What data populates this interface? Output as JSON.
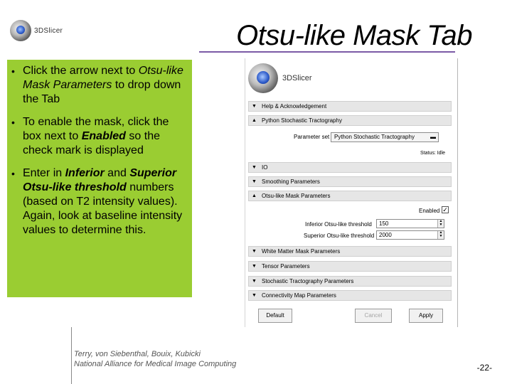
{
  "header": {
    "logo_text": "3DSlicer",
    "title": "Otsu-like Mask Tab"
  },
  "instructions": [
    {
      "parts": [
        {
          "t": "Click the arrow next to ",
          "s": ""
        },
        {
          "t": "Otsu-like Mask Parameters",
          "s": "i"
        },
        {
          "t": " to drop down the Tab",
          "s": ""
        }
      ]
    },
    {
      "parts": [
        {
          "t": "To enable the mask, click the box next to ",
          "s": ""
        },
        {
          "t": "Enabled",
          "s": "bi"
        },
        {
          "t": " so the check mark is displayed",
          "s": ""
        }
      ]
    },
    {
      "parts": [
        {
          "t": "Enter in ",
          "s": ""
        },
        {
          "t": "Inferior",
          "s": "bi"
        },
        {
          "t": " and ",
          "s": ""
        },
        {
          "t": "Superior Otsu-like threshold",
          "s": "bi"
        },
        {
          "t": " numbers (based on T2 intensity values). Again, look at baseline intensity values to determine this.",
          "s": ""
        }
      ]
    }
  ],
  "panel": {
    "logo_text": "3DSlicer",
    "sections": {
      "help": "Help & Acknowledgement",
      "python": "Python Stochastic Tractography",
      "io": "IO",
      "smoothing": "Smoothing Parameters",
      "otsu": "Otsu-like Mask Parameters",
      "white_matter": "White Matter Mask Parameters",
      "tensor": "Tensor Parameters",
      "stochastic": "Stochastic Tractography Parameters",
      "connectivity": "Connectivity Map Parameters"
    },
    "parameter_set_label": "Parameter set",
    "parameter_set_value": "Python Stochastic Tractography",
    "status_text": "Status: Idle",
    "enabled_label": "Enabled",
    "inferior_label": "Inferior Otsu-like threshold",
    "inferior_value": "150",
    "superior_label": "Superior Otsu-like threshold",
    "superior_value": "2000",
    "buttons": {
      "default": "Default",
      "cancel": "Cancel",
      "apply": "Apply"
    }
  },
  "footer": {
    "line1": "Terry, von Siebenthal, Bouix, Kubicki",
    "line2": "National Alliance for Medical Image Computing",
    "page": "-22-"
  }
}
